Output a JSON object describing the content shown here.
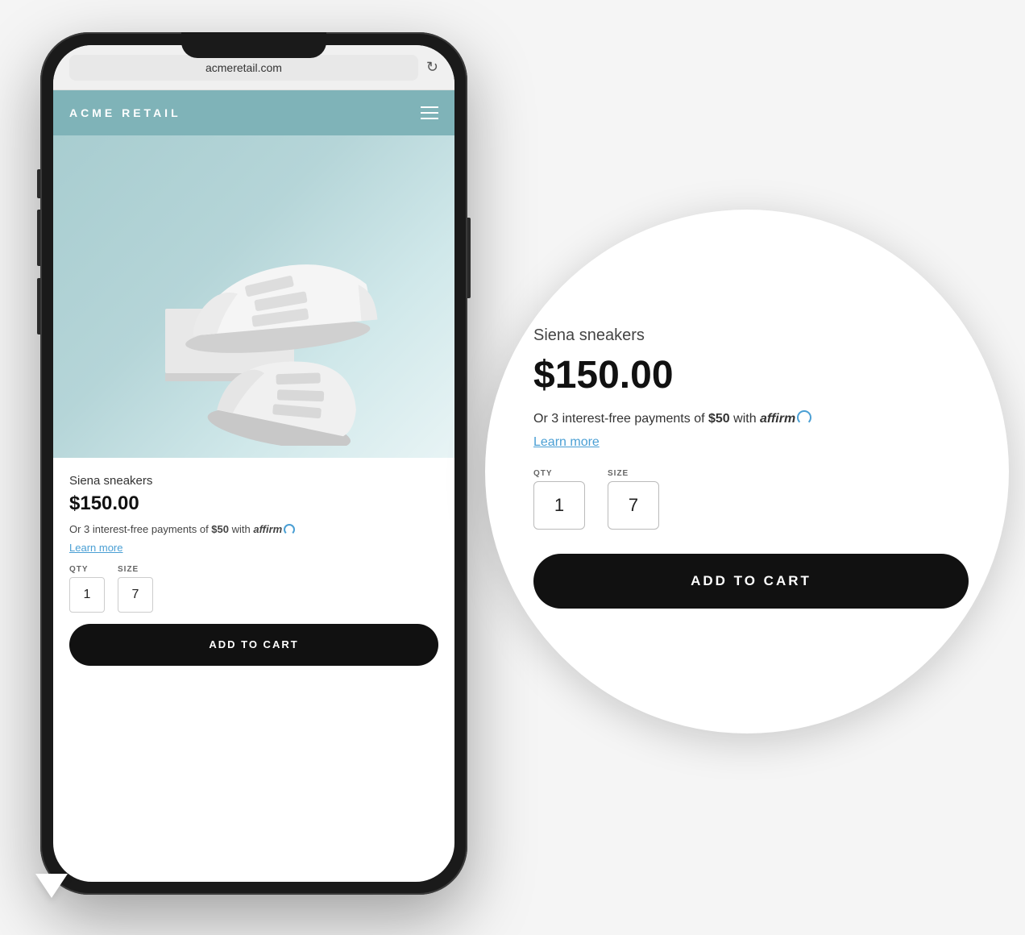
{
  "browser": {
    "url": "acmeretail.com",
    "refresh_icon": "↻"
  },
  "site": {
    "brand": "ACME RETAIL",
    "menu_icon": "hamburger"
  },
  "product": {
    "name": "Siena sneakers",
    "price": "$150.00",
    "affirm_text_prefix": "Or 3 interest-free payments of ",
    "affirm_amount": "$50",
    "affirm_text_mid": " with ",
    "affirm_brand": "affirm",
    "learn_more": "Learn more",
    "qty_label": "QTY",
    "qty_value": "1",
    "size_label": "SIZE",
    "size_value": "7",
    "add_to_cart": "ADD TO CART"
  },
  "bubble": {
    "product_name": "Siena sneakers",
    "price": "$150.00",
    "affirm_text_prefix": "Or 3 interest-free payments of ",
    "affirm_amount": "$50",
    "affirm_text_mid": " with ",
    "affirm_brand": "affirm",
    "learn_more": "Learn more",
    "qty_label": "QTY",
    "qty_value": "1",
    "size_label": "SIZE",
    "size_value": "7",
    "add_to_cart": "ADD TO CART"
  }
}
